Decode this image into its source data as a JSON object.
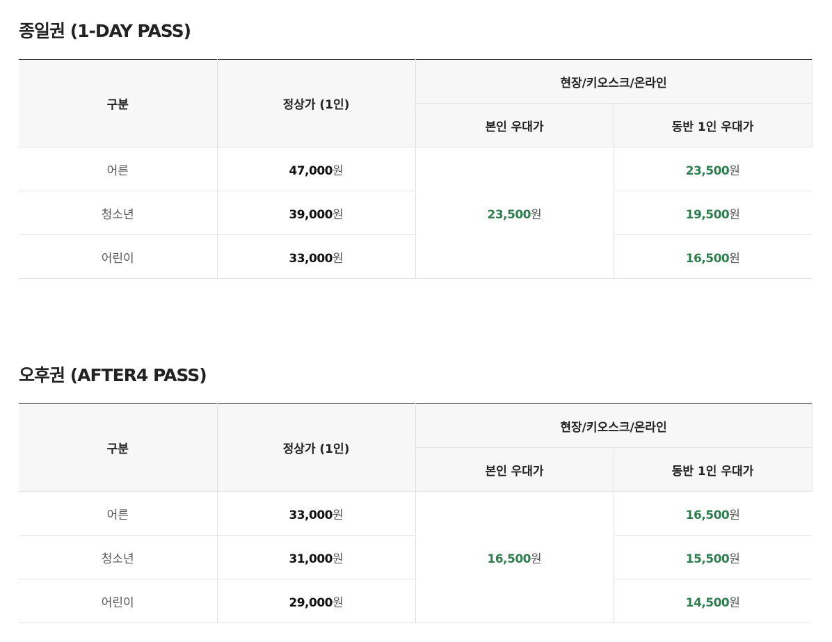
{
  "sections": [
    {
      "title": "종일권 (1-DAY PASS)",
      "headers": {
        "category": "구분",
        "regular": "정상가 (1인)",
        "group": "현장/키오스크/온라인",
        "self": "본인 우대가",
        "companion": "동반 1인 우대가"
      },
      "rows": [
        {
          "category": "어른",
          "regular": "47,000",
          "companion": "23,500"
        },
        {
          "category": "청소년",
          "regular": "39,000",
          "companion": "19,500"
        },
        {
          "category": "어린이",
          "regular": "33,000",
          "companion": "16,500"
        }
      ],
      "self_price": "23,500",
      "currency": "원"
    },
    {
      "title": "오후권 (AFTER4 PASS)",
      "headers": {
        "category": "구분",
        "regular": "정상가 (1인)",
        "group": "현장/키오스크/온라인",
        "self": "본인 우대가",
        "companion": "동반 1인 우대가"
      },
      "rows": [
        {
          "category": "어른",
          "regular": "33,000",
          "companion": "16,500"
        },
        {
          "category": "청소년",
          "regular": "31,000",
          "companion": "15,500"
        },
        {
          "category": "어린이",
          "regular": "29,000",
          "companion": "14,500"
        }
      ],
      "self_price": "16,500",
      "currency": "원"
    }
  ],
  "colors": {
    "accent_green": "#2e7d4f",
    "header_bg": "#f7f7f7",
    "border": "#e2e2e2"
  }
}
